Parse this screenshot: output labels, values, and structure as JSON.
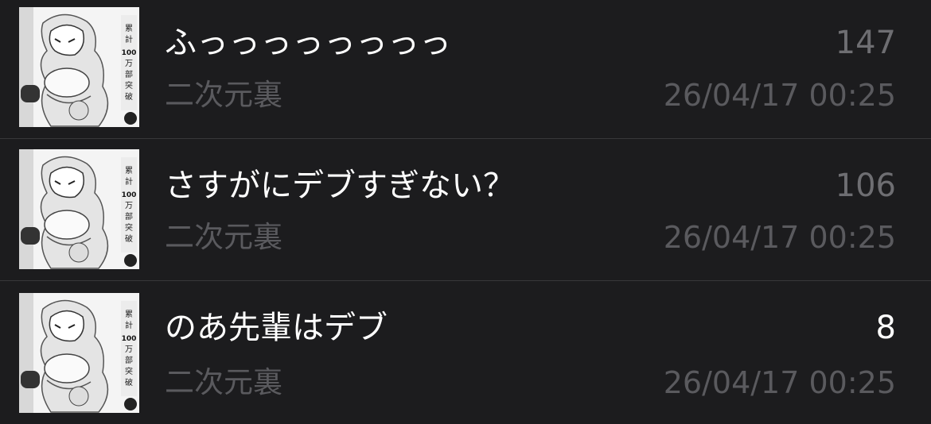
{
  "threads": [
    {
      "title": "ふっっっっっっっっ",
      "count": "147",
      "board": "二次元裏",
      "timestamp": "26/04/17 00:25",
      "thumbnail": "manga-cover-image"
    },
    {
      "title": "さすがにデブすぎない？",
      "count": "106",
      "board": "二次元裏",
      "timestamp": "26/04/17 00:25",
      "thumbnail": "manga-cover-image"
    },
    {
      "title": "のあ先輩はデブ",
      "count": "8",
      "board": "二次元裏",
      "timestamp": "26/04/17 00:25",
      "thumbnail": "manga-cover-image"
    }
  ],
  "colors": {
    "background": "#1c1c1e",
    "separator": "#38383a",
    "title_text": "#ffffff",
    "secondary_text": "#5a5a5e",
    "count_read": "#6e6e72",
    "count_new": "#ffffff"
  }
}
